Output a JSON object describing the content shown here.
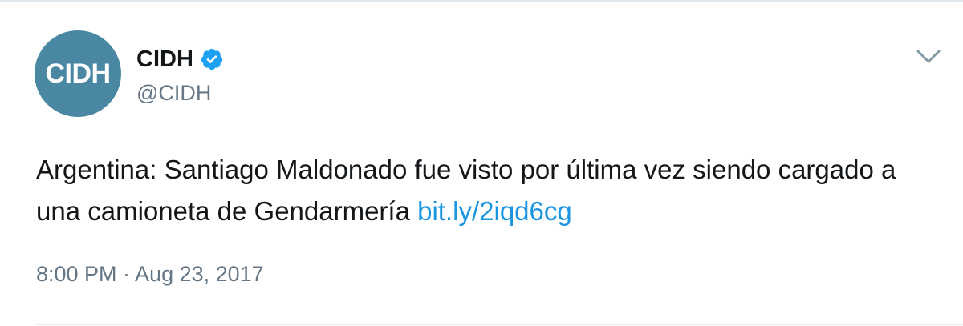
{
  "tweet": {
    "avatar": {
      "text": "CIDH",
      "bg_color": "#4a87a3",
      "accent_color": "#8cc63f"
    },
    "author": {
      "display_name": "CIDH",
      "handle": "@CIDH",
      "verified_icon": "verified-badge-icon",
      "verified_color": "#1da1f2"
    },
    "menu_icon": "chevron-down-icon",
    "text": "Argentina: Santiago Maldonado fue visto por última vez siendo cargado a una camioneta de Gendarmería",
    "link": "bit.ly/2iqd6cg",
    "link_color": "#1b95e0",
    "timestamp": "8:00 PM · Aug 23, 2017"
  }
}
